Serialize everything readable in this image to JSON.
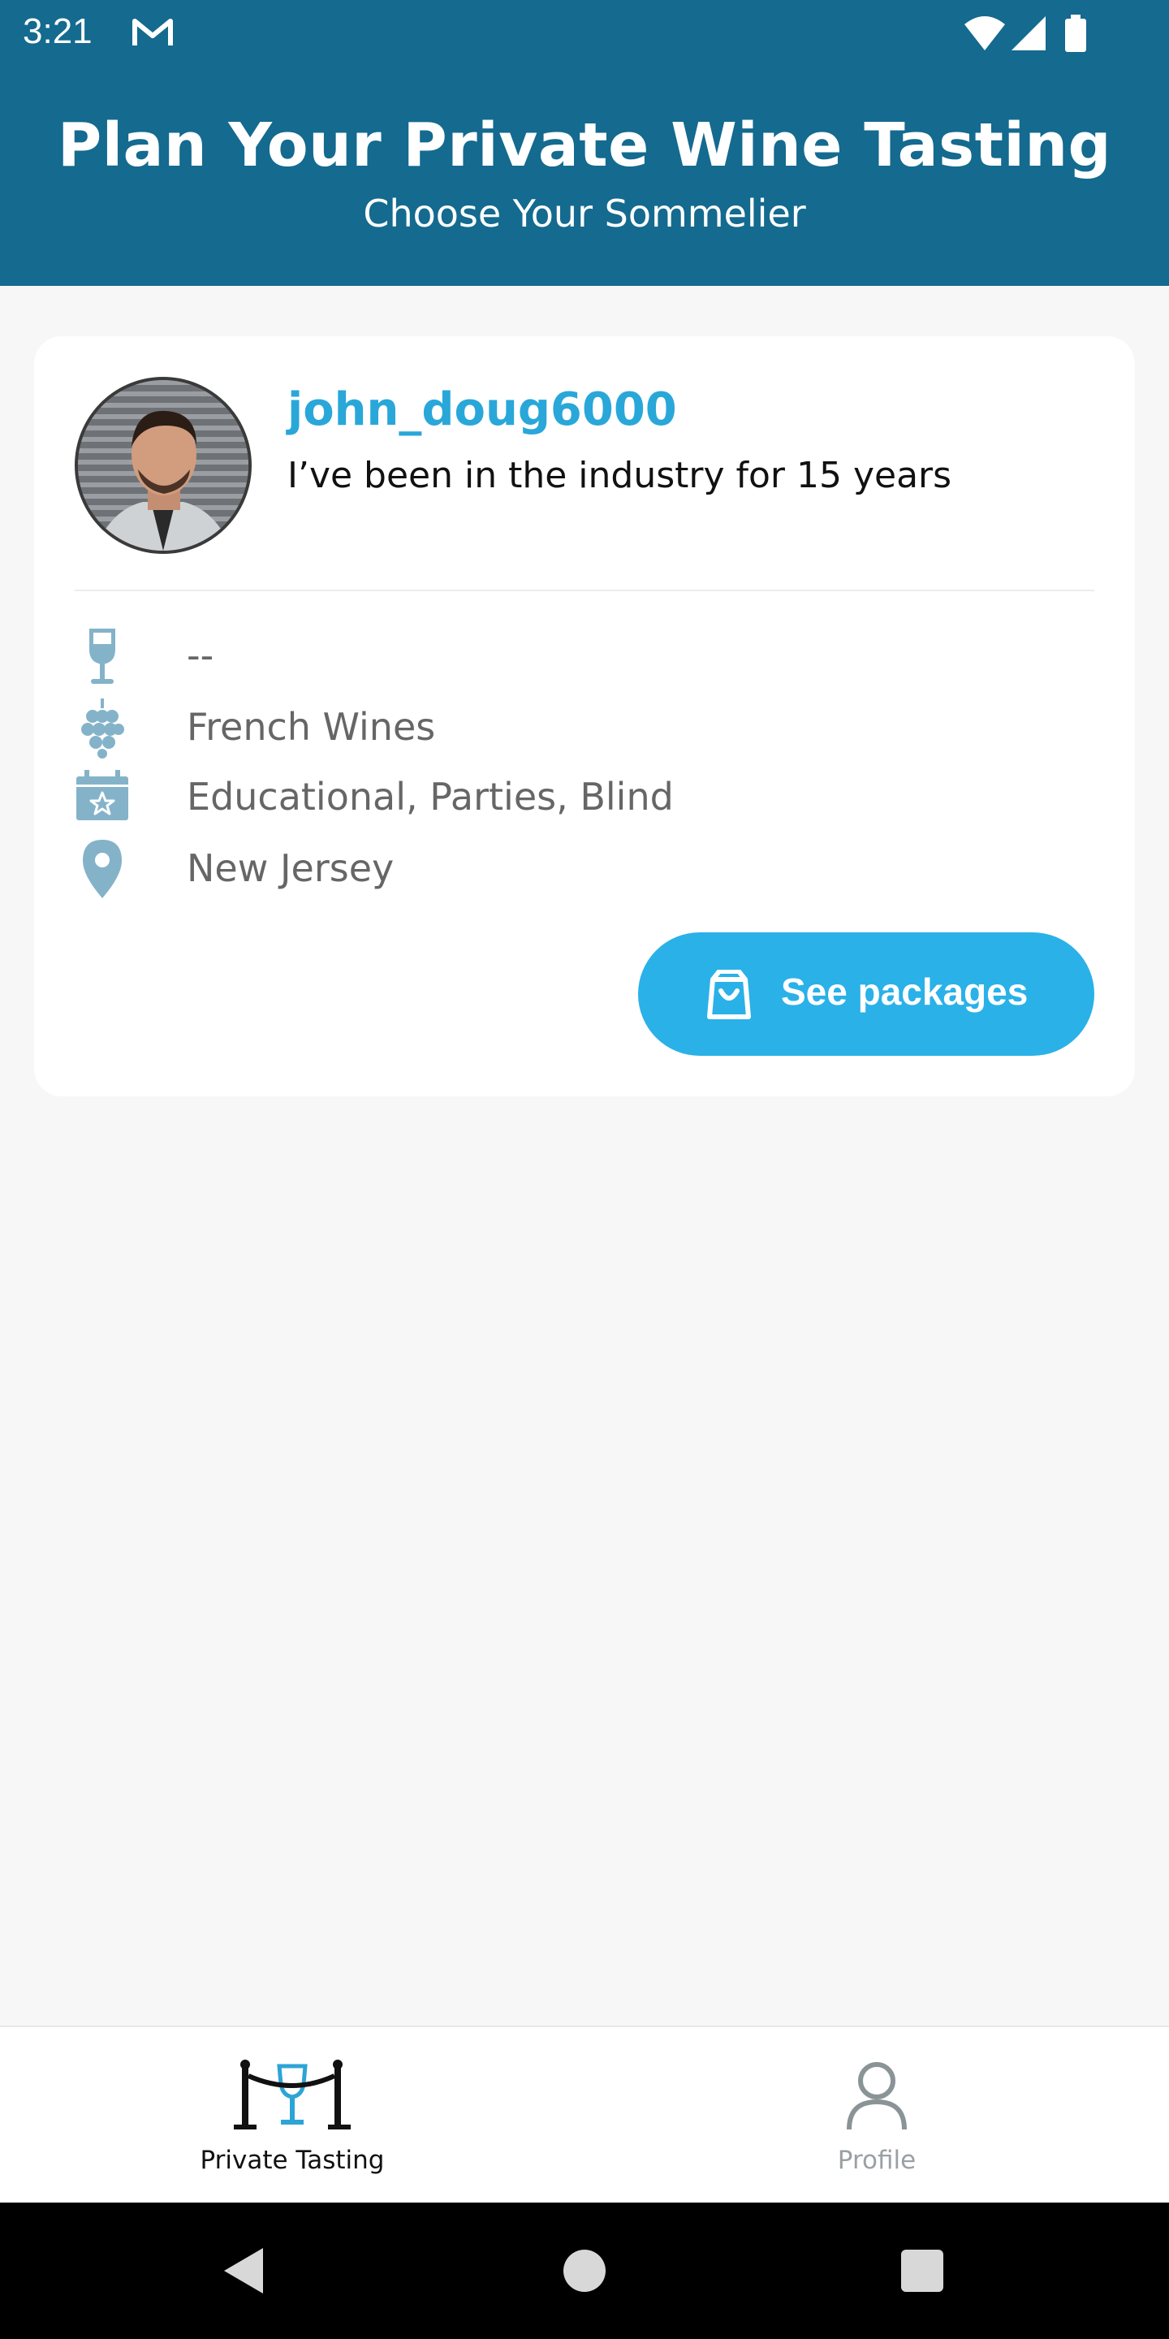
{
  "status_bar": {
    "time": "3:21",
    "icons": [
      "mail-icon",
      "wifi-icon",
      "signal-icon",
      "battery-icon"
    ]
  },
  "header": {
    "title": "Plan Your Private Wine Tasting",
    "subtitle": "Choose Your Sommelier",
    "background": "#146a8f"
  },
  "sommelier": {
    "username": "john_doug6000",
    "bio": "I’ve been in the industry for 15 years",
    "avatar": "profile-photo",
    "details": [
      {
        "icon": "wine-glass-icon",
        "text": "--"
      },
      {
        "icon": "grapes-icon",
        "text": "French Wines"
      },
      {
        "icon": "calendar-star-icon",
        "text": "Educational, Parties, Blind"
      },
      {
        "icon": "location-pin-icon",
        "text": "New Jersey"
      }
    ],
    "action_label": "See packages",
    "accent": "#2ab1e8"
  },
  "bottom_nav": {
    "items": [
      {
        "label": "Private Tasting",
        "icon": "wine-tasting-logo-icon",
        "active": true
      },
      {
        "label": "Profile",
        "icon": "person-icon",
        "active": false
      }
    ]
  },
  "system_nav": [
    "back-icon",
    "home-icon",
    "recents-icon"
  ]
}
